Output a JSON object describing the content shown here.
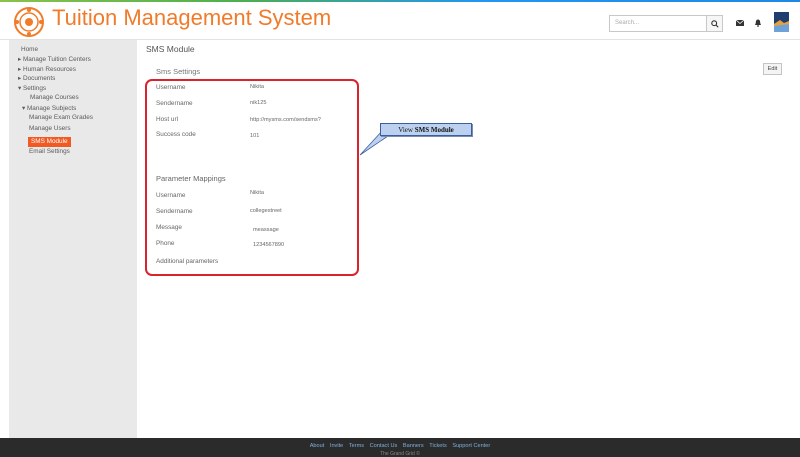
{
  "app": {
    "title": "Tuition Management System"
  },
  "header": {
    "search_placeholder": "Search..."
  },
  "sidebar": {
    "items": [
      {
        "label": "Home"
      },
      {
        "label": "▸ Manage Tuition Centers"
      },
      {
        "label": "▸ Human Resources"
      },
      {
        "label": "▸ Documents"
      },
      {
        "label": "▾ Settings"
      },
      {
        "label": "Manage Courses"
      },
      {
        "label": "▾ Manage Subjects"
      },
      {
        "label": "Manage Exam Grades"
      },
      {
        "label": "Manage Users"
      },
      {
        "label": "SMS Module"
      },
      {
        "label": "Email Settings"
      }
    ],
    "active": "SMS Module"
  },
  "main": {
    "page_title": "SMS Module",
    "section_title": "Sms Settings",
    "edit_label": "Edit",
    "settings": [
      {
        "label": "Username",
        "value": "Nikita"
      },
      {
        "label": "Sendername",
        "value": "nik125"
      },
      {
        "label": "Host url",
        "value": "http://mysms.com/sendsms?"
      },
      {
        "label": "Success code",
        "value": "101"
      }
    ],
    "parameter_title": "Parameter Mappings",
    "parameters": [
      {
        "label": "Username",
        "value": "Nikita"
      },
      {
        "label": "Sendername",
        "value": "collegestreet"
      },
      {
        "label": "Message",
        "value": "meassage"
      },
      {
        "label": "Phone",
        "value": "1234567890"
      },
      {
        "label": "Additional parameters",
        "value": ""
      }
    ]
  },
  "callout": {
    "prefix": "View ",
    "bold": "SMS Module"
  },
  "footer": {
    "links": [
      "About",
      "Invite",
      "Terms",
      "Contact Us",
      "Banners",
      "Tickets",
      "Support Center"
    ],
    "copyright": "The Grand Grid ©"
  },
  "colors": {
    "brand": "#f07b2a",
    "active": "#f15a22",
    "highlight": "#d9232d",
    "callout": "#bcd0ef"
  }
}
